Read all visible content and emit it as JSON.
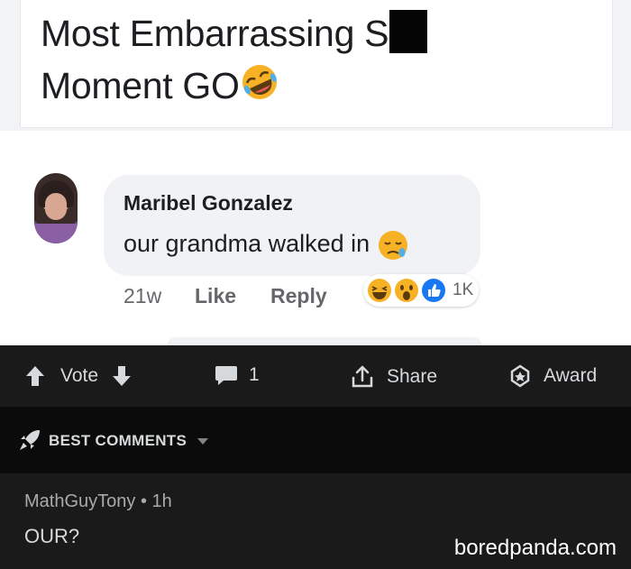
{
  "post": {
    "line1": "Most Embarrassing S",
    "line2": "Moment GO"
  },
  "comment": {
    "author": "Maribel Gonzalez",
    "text": "our grandma walked in",
    "time": "21w",
    "like_label": "Like",
    "reply_label": "Reply",
    "reaction_count": "1K",
    "reactions": [
      "laughing",
      "wow",
      "like"
    ]
  },
  "reddit": {
    "vote_label": "Vote",
    "comment_count": "1",
    "share_label": "Share",
    "award_label": "Award",
    "sort_label": "BEST COMMENTS",
    "reply": {
      "meta": "MathGuyTony • 1h",
      "text": "OUR?"
    }
  },
  "watermark": "boredpanda.com",
  "colors": {
    "fb_blue": "#1877f2",
    "reaction_yellow": "#f7b125",
    "reddit_bg": "#1a1a1b",
    "reddit_text": "#d7dadc"
  }
}
